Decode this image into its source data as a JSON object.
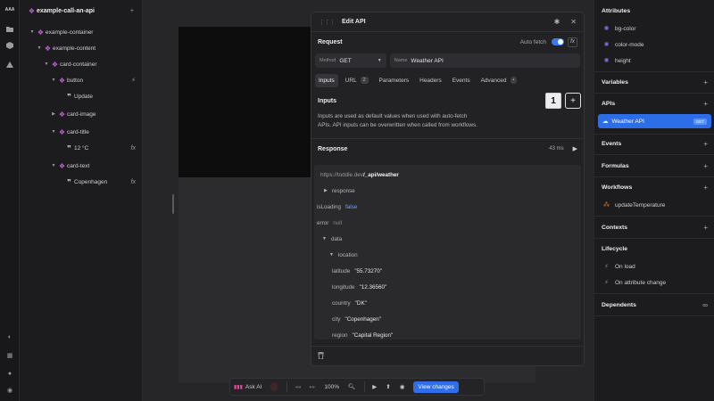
{
  "rail": {
    "logo": "AAA",
    "top_icons": [
      "folder-icon",
      "box-icon",
      "warning-icon"
    ],
    "bottom_icons": [
      "palette-icon",
      "grid-icon",
      "bulb-icon",
      "help-icon"
    ]
  },
  "tree": [
    {
      "label": "example-call-an-api",
      "kind": "component",
      "depth": 0,
      "caret": "",
      "trail": "+"
    },
    {
      "label": "example-container",
      "kind": "component",
      "depth": 1,
      "caret": "▼",
      "trail": ""
    },
    {
      "label": "example-content",
      "kind": "component",
      "depth": 2,
      "caret": "▼",
      "trail": ""
    },
    {
      "label": "card-container",
      "kind": "component",
      "depth": 3,
      "caret": "▼",
      "trail": ""
    },
    {
      "label": "button",
      "kind": "component",
      "depth": 4,
      "caret": "▼",
      "trail": "⚡"
    },
    {
      "label": "Update",
      "kind": "text",
      "depth": 5,
      "caret": "",
      "trail": ""
    },
    {
      "label": "card-image",
      "kind": "component",
      "depth": 4,
      "caret": "▶",
      "trail": ""
    },
    {
      "label": "card-title",
      "kind": "component",
      "depth": 4,
      "caret": "▼",
      "trail": ""
    },
    {
      "label": "12 °C",
      "kind": "text",
      "depth": 5,
      "caret": "",
      "trail": "fx"
    },
    {
      "label": "card-text",
      "kind": "component",
      "depth": 4,
      "caret": "▼",
      "trail": ""
    },
    {
      "label": "Copenhagen",
      "kind": "text",
      "depth": 5,
      "caret": "",
      "trail": "fx"
    }
  ],
  "dialog": {
    "title": "Edit API",
    "request_label": "Request",
    "auto_fetch_label": "Auto fetch",
    "fx_label": "fx",
    "method_key": "Method",
    "method_value": "GET",
    "name_key": "Name",
    "name_value": "Weather API",
    "tabs": [
      {
        "label": "Inputs",
        "badge": ""
      },
      {
        "label": "URL",
        "badge": "2"
      },
      {
        "label": "Parameters",
        "badge": ""
      },
      {
        "label": "Headers",
        "badge": ""
      },
      {
        "label": "Events",
        "badge": ""
      },
      {
        "label": "Advanced",
        "badge": "•"
      }
    ],
    "inputs_title": "Inputs",
    "inputs_count": "1",
    "inputs_desc_1": "Inputs are used as default values when used with auto-fetch",
    "inputs_desc_2": "APIs. API inputs can be overwritten when called from workflows.",
    "response_title": "Response",
    "response_time": "43 ms",
    "url_prefix": "https://toddle.dev",
    "url_path": "/_api/weather",
    "response_node": "response",
    "is_loading_key": "isLoading",
    "is_loading_value": "false",
    "error_key": "error",
    "error_value": "null",
    "data_key": "data",
    "location_key": "location",
    "location": [
      {
        "key": "latitude",
        "value": "\"55.73270\""
      },
      {
        "key": "longitude",
        "value": "\"12.36560\""
      },
      {
        "key": "country",
        "value": "\"DK\""
      },
      {
        "key": "city",
        "value": "\"Copenhagen\""
      },
      {
        "key": "region",
        "value": "\"Capital Region\""
      }
    ]
  },
  "right": {
    "attributes_title": "Attributes",
    "attributes": [
      "bg-color",
      "color-mode",
      "height"
    ],
    "variables_title": "Variables",
    "apis_title": "APIs",
    "api_selected": "Weather API",
    "api_method": "GET",
    "events_title": "Events",
    "formulas_title": "Formulas",
    "workflows_title": "Workflows",
    "workflow_item": "updateTemperature",
    "contexts_title": "Contexts",
    "lifecycle_title": "Lifecycle",
    "lifecycle": [
      "On load",
      "On attribute change"
    ],
    "dependents_title": "Dependents"
  },
  "toolbar": {
    "ask_ai": "Ask AI",
    "zoom": "100%",
    "view_changes": "View changes"
  },
  "colors": {
    "accent": "#2d6ee8",
    "component": "#c062d8",
    "boolean": "#6aa2f8"
  }
}
